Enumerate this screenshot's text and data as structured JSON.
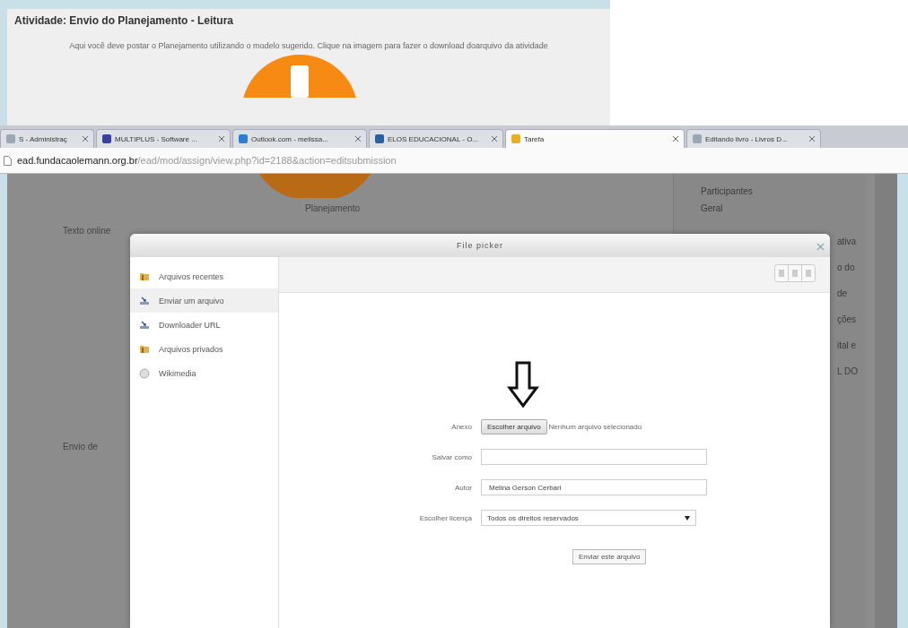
{
  "activity": {
    "title": "Atividade: Envio do Planejamento - Leitura",
    "description": "Aqui você deve postar o Planejamento utilizando o modelo sugerido. Clique na imagem para fazer o download doarquivo da atividade"
  },
  "browser": {
    "tabs": [
      {
        "label": "S - Administraç",
        "selected": false,
        "color": "#9aa7b4"
      },
      {
        "label": "MULTIPLUS - Software ...",
        "selected": false,
        "color": "#3b3fa0"
      },
      {
        "label": "Outlook.com - melissa...",
        "selected": false,
        "color": "#2a7fd0"
      },
      {
        "label": "ELOS EDUCACIONAL - O...",
        "selected": false,
        "color": "#2a5fa0"
      },
      {
        "label": "Tarefa",
        "selected": true,
        "color": "#e8b020"
      },
      {
        "label": "Editando livro - Livros D...",
        "selected": false,
        "color": "#9aa7b4"
      }
    ],
    "url_host": "ead.fundacaolemann.org.br",
    "url_path": "/ead/mod/assign/view.php?id=2188&action=editsubmission"
  },
  "page": {
    "image_caption": "Planejamento",
    "sections": [
      "Texto online",
      "Envio de"
    ],
    "sidebar": [
      "Participantes",
      "Geral",
      "ativa",
      "o do",
      "de",
      "ções",
      "ital e",
      "L DO"
    ]
  },
  "file_picker": {
    "title": "File picker",
    "repositories": [
      {
        "label": "Arquivos recentes",
        "kind": "folder",
        "selected": false
      },
      {
        "label": "Enviar um arquivo",
        "kind": "upload",
        "selected": true
      },
      {
        "label": "Downloader URL",
        "kind": "upload",
        "selected": false
      },
      {
        "label": "Arquivos privados",
        "kind": "folder",
        "selected": false
      },
      {
        "label": "Wikimedia",
        "kind": "globe",
        "selected": false
      }
    ],
    "form": {
      "attachment_label": "Anexo",
      "choose_button": "Escolher arquivo",
      "no_file": "Nenhum arquivo selecionado",
      "save_as_label": "Salvar como",
      "author_label": "Autor",
      "author": "Melina Gerson Cerbari",
      "license_label": "Escolher licença",
      "license": "Todos os direitos reservados",
      "submit": "Enviar este arquivo"
    }
  }
}
